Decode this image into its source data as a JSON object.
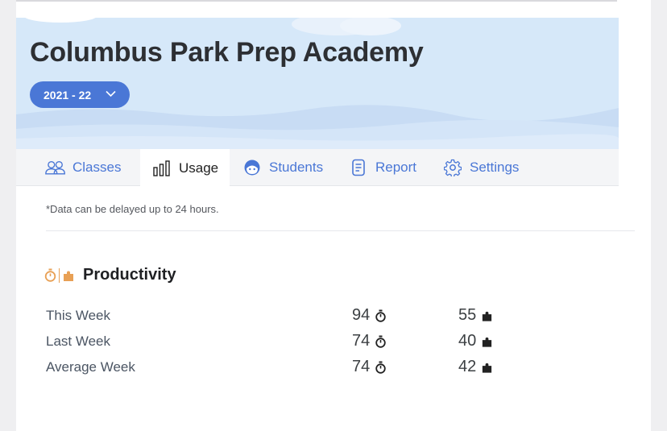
{
  "school": {
    "name": "Columbus Park Prep Academy",
    "year_selector": "2021 - 22"
  },
  "tabs": [
    {
      "label": "Classes",
      "icon": "people-icon"
    },
    {
      "label": "Usage",
      "icon": "bar-chart-icon",
      "active": true
    },
    {
      "label": "Students",
      "icon": "student-face-icon"
    },
    {
      "label": "Report",
      "icon": "report-icon"
    },
    {
      "label": "Settings",
      "icon": "gear-icon"
    }
  ],
  "notice": "*Data can be delayed up to 24 hours.",
  "productivity": {
    "title": "Productivity",
    "rows": [
      {
        "label": "This Week",
        "minutes": "94",
        "puzzles": "55"
      },
      {
        "label": "Last Week",
        "minutes": "74",
        "puzzles": "40"
      },
      {
        "label": "Average Week",
        "minutes": "74",
        "puzzles": "42"
      }
    ]
  },
  "colors": {
    "accent": "#4a77d6",
    "hero_bg": "#d6e8f9",
    "productivity_icon": "#e8a055"
  }
}
